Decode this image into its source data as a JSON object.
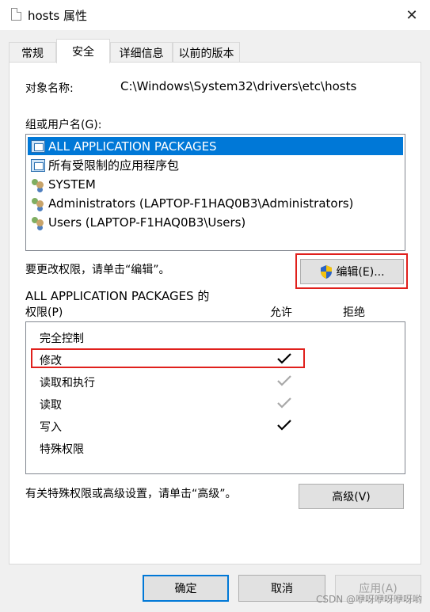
{
  "window": {
    "title": "hosts 属性",
    "close_icon": "close-icon"
  },
  "tabs": [
    {
      "label": "常规"
    },
    {
      "label": "安全",
      "active": true
    },
    {
      "label": "详细信息"
    },
    {
      "label": "以前的版本"
    }
  ],
  "object": {
    "label": "对象名称:",
    "value": "C:\\Windows\\System32\\drivers\\etc\\hosts"
  },
  "groups": {
    "label": "组或用户名(G):",
    "items": [
      {
        "name": "ALL APPLICATION PACKAGES",
        "icon": "app-package-icon",
        "selected": true
      },
      {
        "name": "所有受限制的应用程序包",
        "icon": "app-package-icon"
      },
      {
        "name": "SYSTEM",
        "icon": "users-icon"
      },
      {
        "name": "Administrators (LAPTOP-F1HAQ0B3\\Administrators)",
        "icon": "users-icon"
      },
      {
        "name": "Users (LAPTOP-F1HAQ0B3\\Users)",
        "icon": "users-icon"
      }
    ]
  },
  "edit": {
    "hint": "要更改权限，请单击“编辑”。",
    "button_label": "编辑(E)...",
    "icon": "uac-shield-icon"
  },
  "permissions": {
    "header_line1": "ALL APPLICATION PACKAGES 的",
    "header_line2": "权限(P)",
    "allow_label": "允许",
    "deny_label": "拒绝",
    "rows": [
      {
        "name": "完全控制",
        "allow": "none"
      },
      {
        "name": "修改",
        "allow": "checked"
      },
      {
        "name": "读取和执行",
        "allow": "inherited"
      },
      {
        "name": "读取",
        "allow": "inherited"
      },
      {
        "name": "写入",
        "allow": "checked"
      },
      {
        "name": "特殊权限",
        "allow": "none"
      }
    ]
  },
  "advanced": {
    "hint": "有关特殊权限或高级设置，请单击“高级”。",
    "button_label": "高级(V)"
  },
  "footer": {
    "ok_label": "确定",
    "cancel_label": "取消",
    "apply_label": "应用(A)"
  },
  "watermark": "CSDN @咿呀咿呀咿呀哟",
  "colors": {
    "selection": "#0078d7",
    "highlight_box": "#e0201c",
    "check_active": "#000000",
    "check_inherited": "#a8a8a8"
  }
}
